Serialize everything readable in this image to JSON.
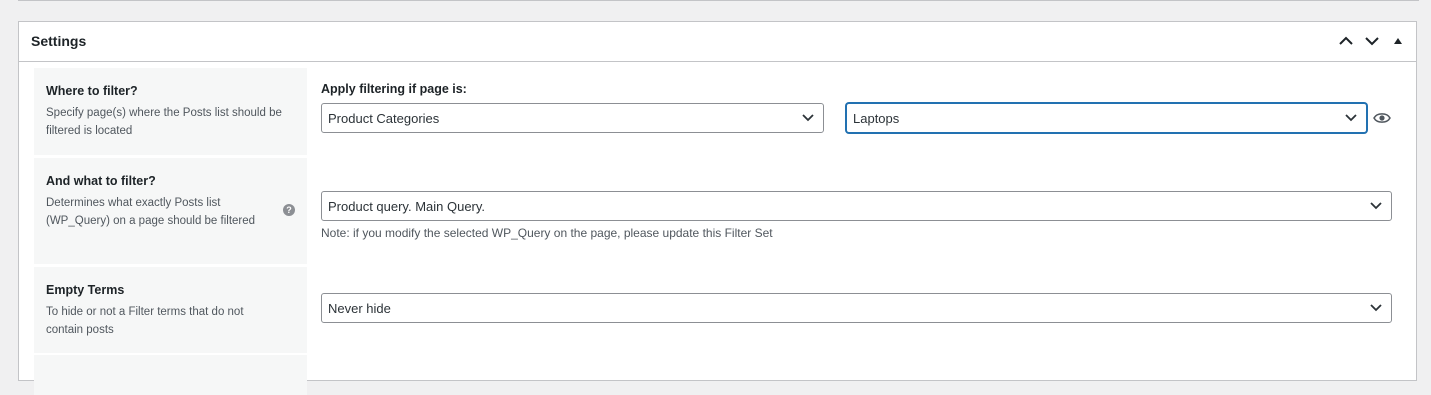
{
  "panel": {
    "title": "Settings",
    "actions": {
      "move_up_icon": "chevron-up-icon",
      "move_down_icon": "chevron-down-icon",
      "toggle_icon": "triangle-up-icon"
    }
  },
  "rows": [
    {
      "label": "Where to filter?",
      "description": "Specify page(s) where the Posts list should be filtered is located",
      "field_title": "Apply filtering if page is:",
      "select_primary": "Product Categories",
      "select_secondary": "Laptops",
      "preview_icon": "eye-icon"
    },
    {
      "label": "And what to filter?",
      "description": "Determines what exactly Posts list (WP_Query) on a page should be filtered",
      "help_icon": "?",
      "select": "Product query. Main Query.",
      "note": "Note: if you modify the selected WP_Query on the page, please update this Filter Set"
    },
    {
      "label": "Empty Terms",
      "description": "To hide or not a Filter terms that do not contain posts",
      "select": "Never hide"
    }
  ],
  "colors": {
    "accent": "#2271b1",
    "border": "#c3c4c7",
    "label_bg": "#f6f7f7",
    "background": "#f0f0f1"
  }
}
